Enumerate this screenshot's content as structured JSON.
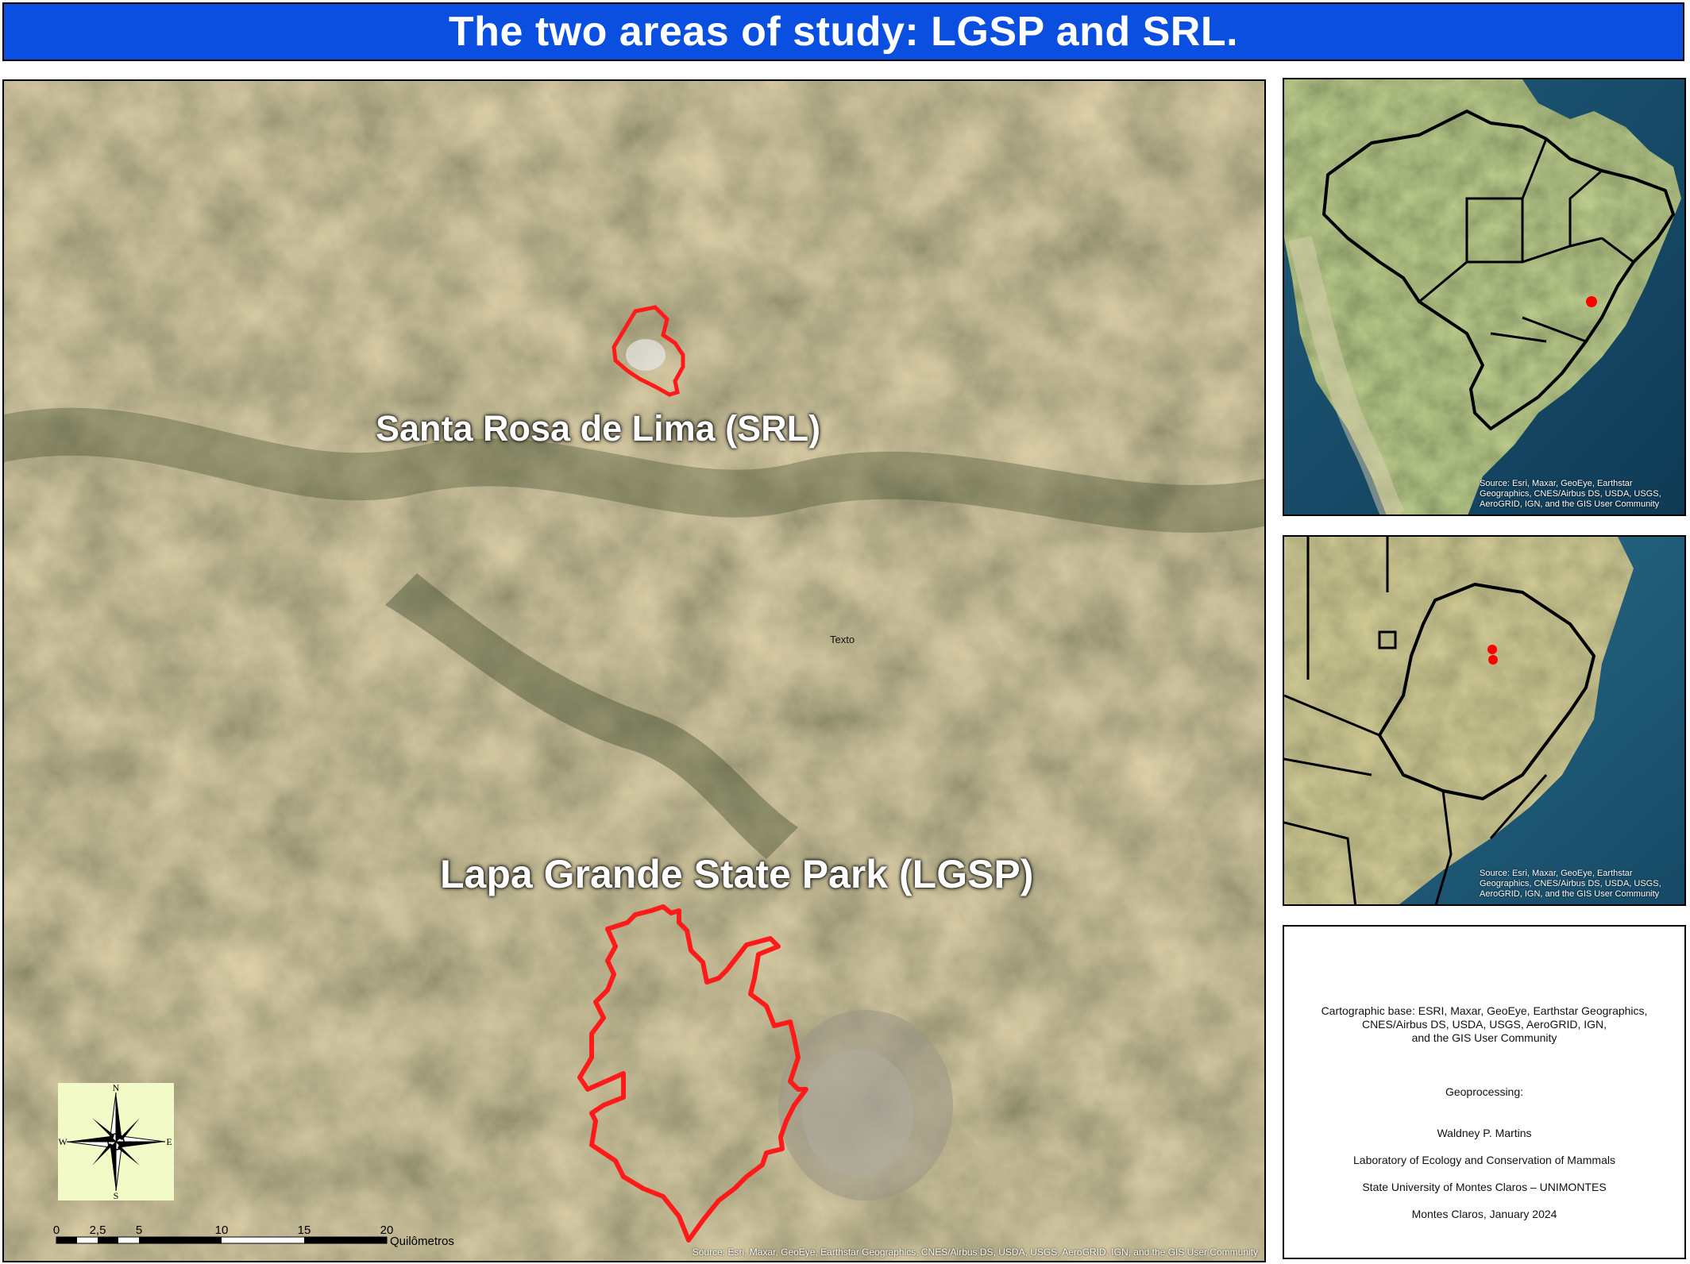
{
  "title": "The two areas of study: LGSP and SRL.",
  "main_map": {
    "label_srl": "Santa Rosa de Lima (SRL)",
    "label_lgsp": "Lapa Grande State Park (LGSP)",
    "placeholder_text": "Texto",
    "attribution": "Source: Esri, Maxar, GeoEye, Earthstar Geographics, CNES/Airbus DS, USDA, USGS, AeroGRID, IGN, and the GIS User Community",
    "boundary_color": "#ff1a1a",
    "compass": {
      "n": "N",
      "s": "S",
      "e": "E",
      "w": "W"
    },
    "scale": {
      "ticks": [
        "0",
        "2,5",
        "5",
        "10",
        "15",
        "20"
      ],
      "unit": "Quilômetros"
    }
  },
  "inset_brazil": {
    "attribution": "Source: Esri, Maxar, GeoEye, Earthstar Geographics, CNES/Airbus DS, USDA, USGS, AeroGRID, IGN, and the GIS User Community",
    "marker_color": "#ff0000"
  },
  "inset_region": {
    "attribution": "Source: Esri, Maxar, GeoEye, Earthstar Geographics, CNES/Airbus DS, USDA, USGS, AeroGRID, IGN, and the GIS User Community",
    "marker_color": "#ff0000"
  },
  "credits": {
    "cartographic_base": "Cartographic base: ESRI, Maxar, GeoEye, Earthstar Geographics,",
    "cartographic_base_2": "CNES/Airbus DS, USDA, USGS, AeroGRID, IGN,",
    "cartographic_base_3": "and the GIS User Community",
    "geoprocessing": "Geoprocessing:",
    "author": "Waldney P. Martins",
    "lab": "Laboratory of Ecology and Conservation of Mammals",
    "university": "State University of Montes Claros – UNIMONTES",
    "place_date": "Montes Claros, January 2024"
  }
}
